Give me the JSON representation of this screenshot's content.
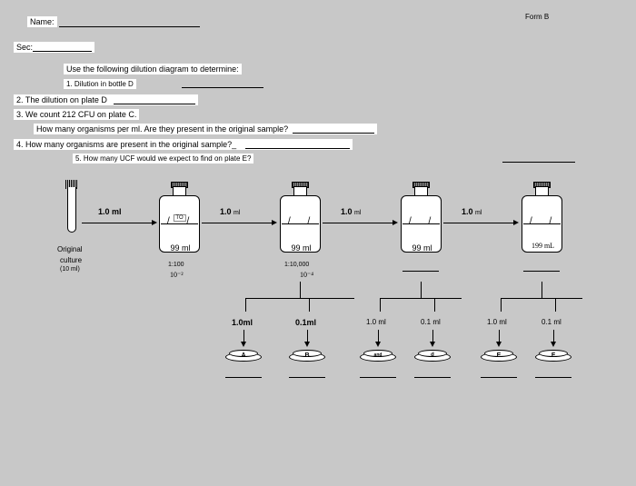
{
  "form": "Form B",
  "labels": {
    "name": "Name:",
    "sec": "Sec:"
  },
  "instructions": "Use the following dilution diagram to determine:",
  "questions": {
    "q1": "1. Dilution in bottle D",
    "q2": "2. The dilution on plate D",
    "q3a": "3. We count 212 CFU on plate C.",
    "q3b": "How many organisms per ml. Are they present in the original sample?",
    "q4": "4. How many organisms are present in the original sample?_",
    "q5": "5. How many UCF would we expect to find on plate E?"
  },
  "diagram": {
    "original": {
      "line1": "Original",
      "line2": "culture",
      "line3": "(10 ml)"
    },
    "transfer_vol_bold": "1.0 ml",
    "transfer_vol": "1.0",
    "unit_ml": "ml",
    "to": "TO",
    "bottle_vol": "99 ml",
    "bottle_vol_hand": "199 mL",
    "dil1": "1:100",
    "dil1_hand": "10⁻²",
    "dil2": "1:10,000",
    "dil2_hand": "10⁻⁴",
    "plate_vols": {
      "a": "1.0ml",
      "b": "0.1ml",
      "c": "1.0 ml",
      "d": "0.1 ml",
      "e": "1.0 ml",
      "f": "0.1 ml"
    },
    "plates": {
      "a": "A",
      "b": "B",
      "c": "and",
      "d": "d",
      "e": "E",
      "f": "F"
    }
  }
}
